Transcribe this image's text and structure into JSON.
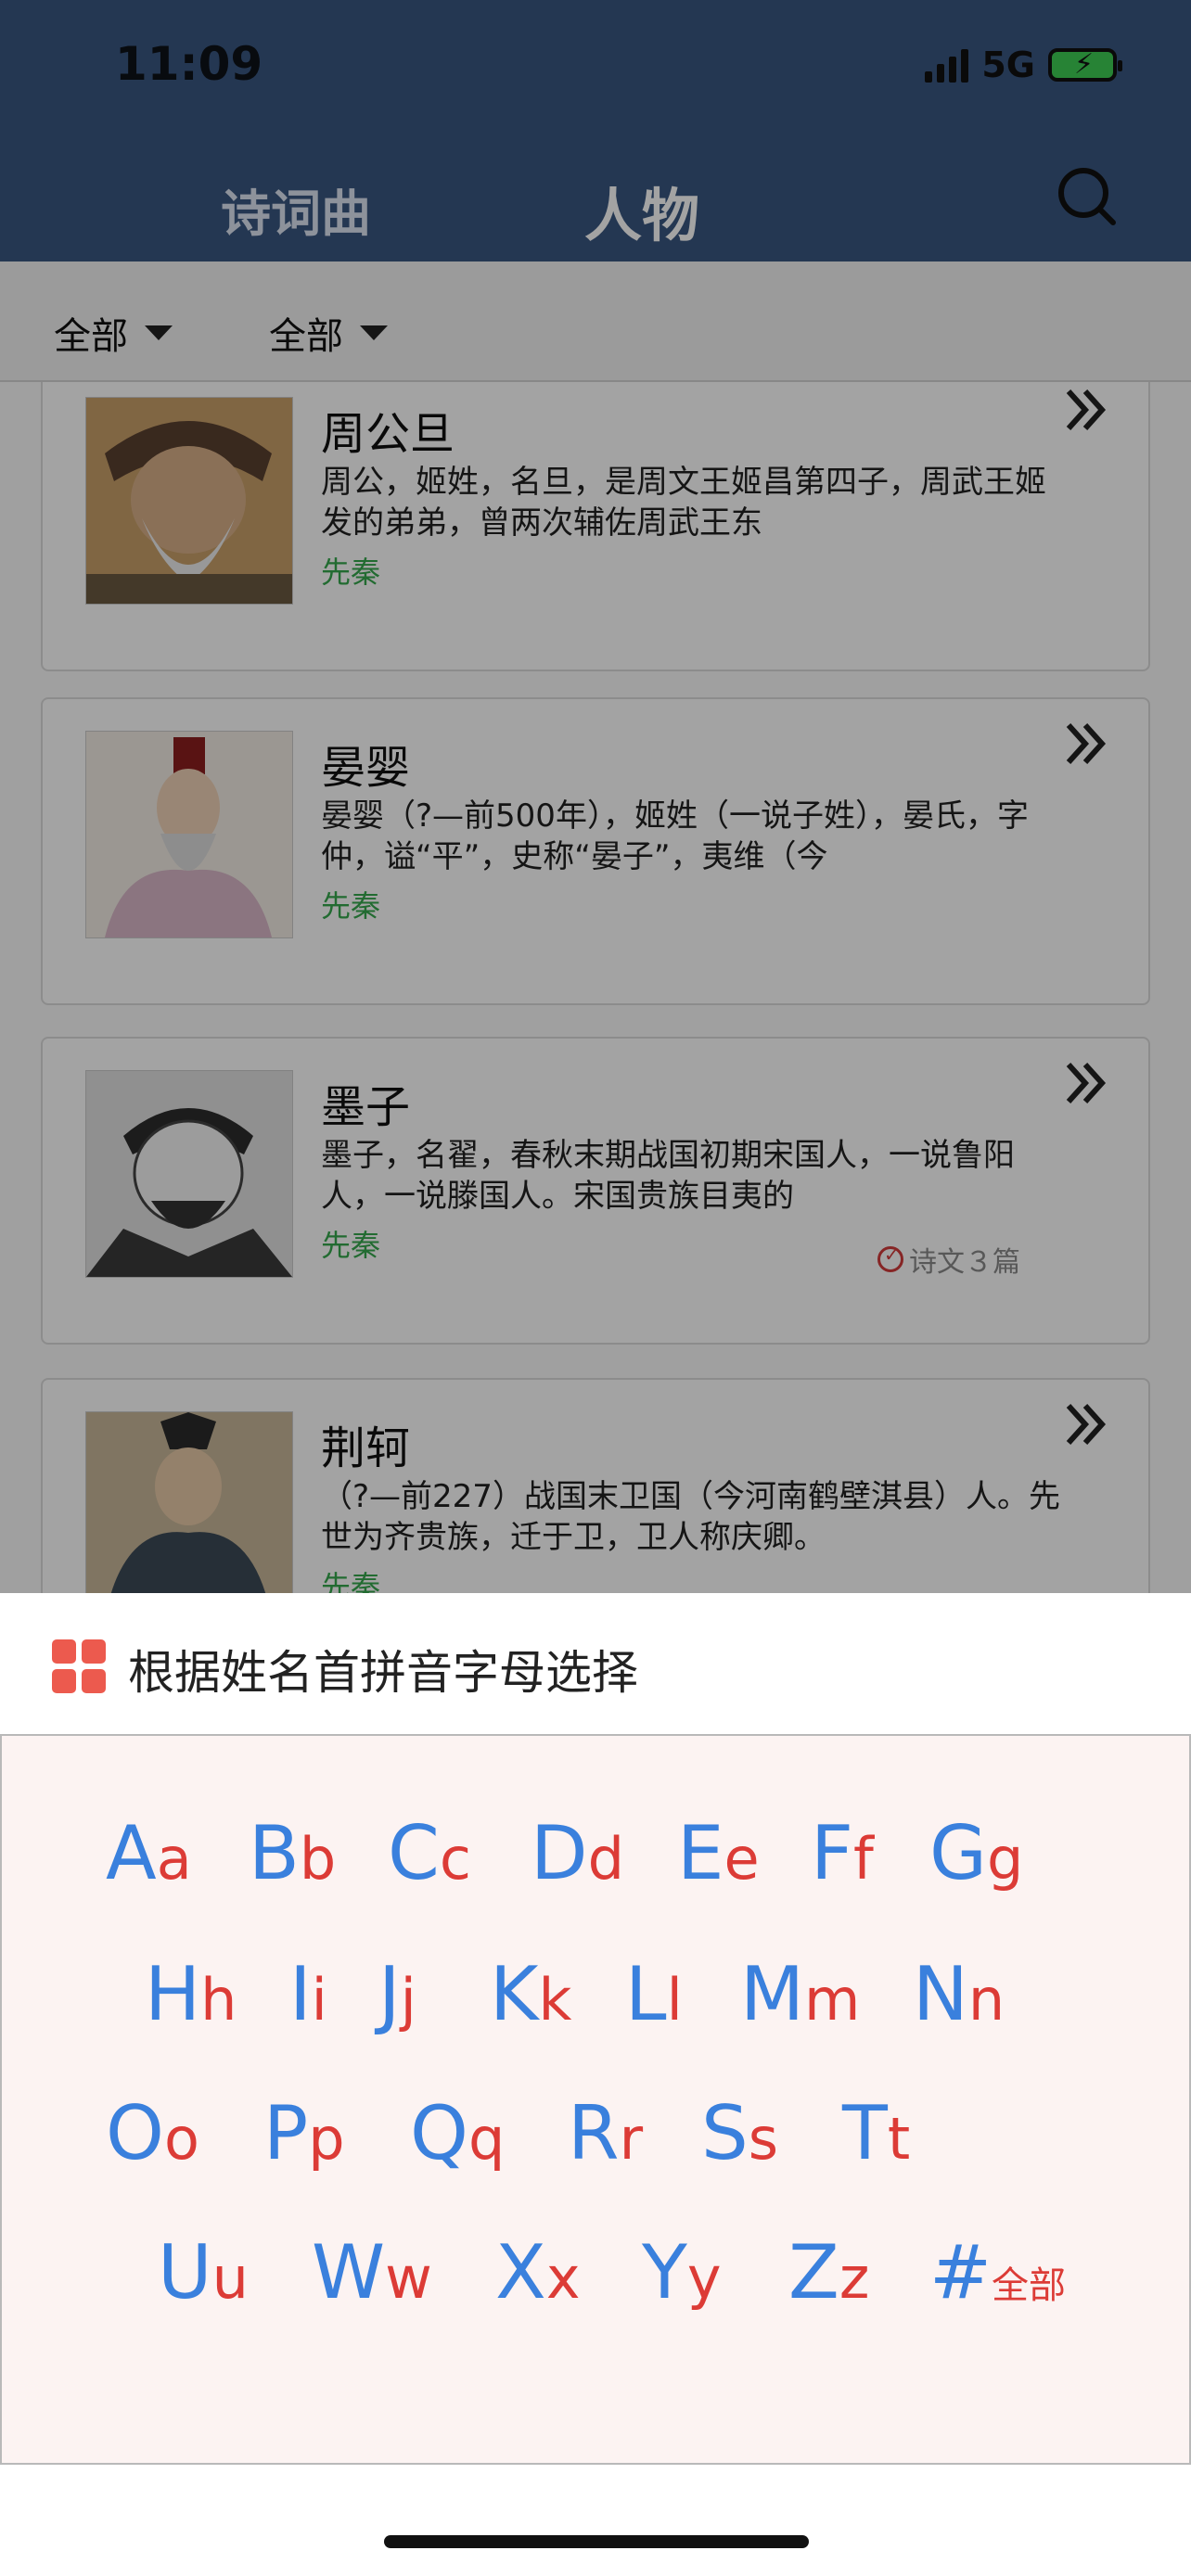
{
  "status_bar": {
    "time": "11:09",
    "network": "5G"
  },
  "header": {
    "tabs": [
      {
        "label": "诗词曲"
      },
      {
        "label": "人物"
      }
    ],
    "search_icon": "search-icon"
  },
  "filters": [
    {
      "label": "全部"
    },
    {
      "label": "全部"
    }
  ],
  "people": [
    {
      "name": "周公旦",
      "desc": "周公，姬姓，名旦，是周文王姬昌第四子，周武王姬发的弟弟，曾两次辅佐周武王东",
      "era": "先秦"
    },
    {
      "name": "晏婴",
      "desc": "晏婴（?—前500年），姬姓（一说子姓），晏氏，字仲，谥“平”，史称“晏子”，夷维（今",
      "era": "先秦"
    },
    {
      "name": "墨子",
      "desc": "墨子，名翟，春秋末期战国初期宋国人，一说鲁阳人，一说滕国人。宋国贵族目夷的",
      "era": "先秦",
      "poem_count": "诗文３篇"
    },
    {
      "name": "荆轲",
      "desc": "（?—前227）战国末卫国（今河南鹤壁淇县）人。先世为齐贵族，迁于卫，卫人称庆卿。",
      "era": "先秦"
    }
  ],
  "sheet": {
    "title": "根据姓名首拼音字母选择",
    "icon": "grid-icon",
    "rows": [
      [
        {
          "u": "A",
          "l": "a"
        },
        {
          "u": "B",
          "l": "b"
        },
        {
          "u": "C",
          "l": "c"
        },
        {
          "u": "D",
          "l": "d"
        },
        {
          "u": "E",
          "l": "e"
        },
        {
          "u": "F",
          "l": "f"
        },
        {
          "u": "G",
          "l": "g"
        }
      ],
      [
        {
          "u": "H",
          "l": "h"
        },
        {
          "u": "I",
          "l": "i"
        },
        {
          "u": "J",
          "l": "j"
        },
        {
          "u": "K",
          "l": "k"
        },
        {
          "u": "L",
          "l": "l"
        },
        {
          "u": "M",
          "l": "m"
        },
        {
          "u": "N",
          "l": "n"
        }
      ],
      [
        {
          "u": "O",
          "l": "o"
        },
        {
          "u": "P",
          "l": "p"
        },
        {
          "u": "Q",
          "l": "q"
        },
        {
          "u": "R",
          "l": "r"
        },
        {
          "u": "S",
          "l": "s"
        },
        {
          "u": "T",
          "l": "t"
        }
      ],
      [
        {
          "u": "U",
          "l": "u"
        },
        {
          "u": "W",
          "l": "w"
        },
        {
          "u": "X",
          "l": "x"
        },
        {
          "u": "Y",
          "l": "y"
        },
        {
          "u": "Z",
          "l": "z"
        },
        {
          "u": "#",
          "l": "全部"
        }
      ]
    ]
  },
  "colors": {
    "header": "#395680",
    "uppercase": "#3a80dd",
    "lowercase": "#dc3b36",
    "era": "#36a84d",
    "sheet_bg": "#fcf3f2"
  }
}
